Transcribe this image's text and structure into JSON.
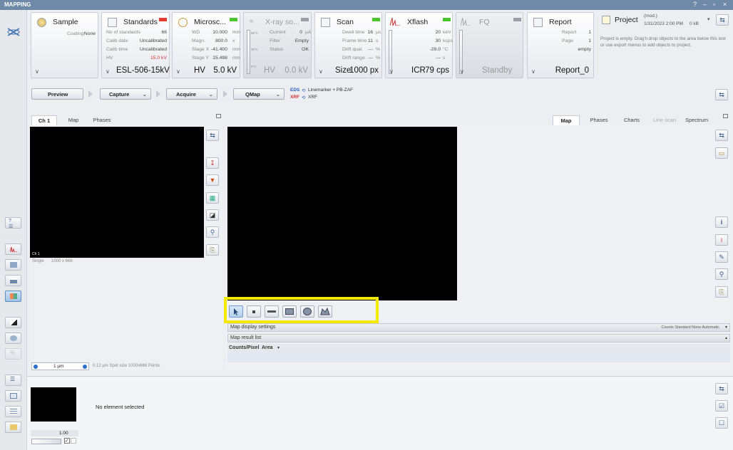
{
  "window": {
    "title": "MAPPING",
    "controls": [
      "?",
      "–",
      "▫",
      "×"
    ]
  },
  "sample": {
    "title": "Sample",
    "coating_label": "Coating",
    "coating_value": "None"
  },
  "standards": {
    "title": "Standards",
    "led": "#e23b2e",
    "rows": [
      {
        "k": "No of standards",
        "v": "66"
      },
      {
        "k": "Calib date",
        "v": "Uncalibrated"
      },
      {
        "k": "Calib time",
        "v": "Uncalibrated"
      },
      {
        "k": "HV",
        "v": "15.0 kV"
      }
    ],
    "footer": "ESL-506-15kV"
  },
  "microscope": {
    "title": "Microsc...",
    "led": "#4cc42f",
    "rows": [
      {
        "k": "WD",
        "v": "10.000",
        "u": "mm"
      },
      {
        "k": "Magn.",
        "v": "800.0",
        "u": "x"
      },
      {
        "k": "Stage X",
        "v": "-41.400",
        "u": "mm"
      },
      {
        "k": "Stage Y",
        "v": "15.498",
        "u": "mm"
      }
    ],
    "footer_label": "HV",
    "footer_value": "5.0 kV"
  },
  "xray": {
    "title": "X-ray so...",
    "led": "#9aa0a8",
    "scale": [
      "60°C",
      "30°C",
      "0°C"
    ],
    "rows": [
      {
        "k": "Current",
        "v": "0",
        "u": "μA"
      },
      {
        "k": "Filter",
        "v": "Empty",
        "u": ""
      },
      {
        "k": "Status",
        "v": "OK",
        "u": ""
      }
    ],
    "footer_label": "HV",
    "footer_value": "0.0 kV"
  },
  "scan": {
    "title": "Scan",
    "led": "#4cc42f",
    "rows": [
      {
        "k": "Dwell time",
        "v": "16",
        "u": "μs"
      },
      {
        "k": "Frame time",
        "v": "11",
        "u": "s"
      },
      {
        "k": "Drift qual.",
        "v": "---",
        "u": "%"
      },
      {
        "k": "Drift range",
        "v": "---",
        "u": "%"
      }
    ],
    "footer_label": "Size",
    "footer_value": "1000 px"
  },
  "xflash": {
    "title": "Xflash",
    "led": "#4cc42f",
    "rows": [
      {
        "v": "20",
        "u": "keV"
      },
      {
        "v": "30",
        "u": "kcps"
      },
      {
        "v": "-29.0",
        "u": "°C"
      },
      {
        "v": "---",
        "u": "s"
      }
    ],
    "footer_label": "ICR",
    "footer_value": "79 cps"
  },
  "fq": {
    "title": "FQ",
    "led": "#9aa0a8",
    "footer": "Standby"
  },
  "report": {
    "title": "Report",
    "rows": [
      {
        "k": "Report",
        "v": "1"
      },
      {
        "k": "Page",
        "v": "1"
      },
      {
        "k": "",
        "v": "empty"
      }
    ],
    "footer": "Report_0"
  },
  "project": {
    "title": "Project",
    "mod": "(mod.)",
    "date": "1/31/2023 2:00 PM",
    "size": "0 kB",
    "info": "Project is empty. Drag'n drop objects to the area below this text or use export menus to add objects to project."
  },
  "workflow": {
    "preview": "Preview",
    "capture": "Capture",
    "acquire": "Acquire",
    "qmap": "QMap",
    "eds_label": "EDS",
    "eds_text": "Linemarker + PB-ZAF",
    "xrf_label": "XRF",
    "xrf_text": "XRF"
  },
  "left_tabs": [
    "Ch 1",
    "Map",
    "Phases"
  ],
  "left_image": {
    "tag": "Ch 1",
    "mode": "Single",
    "dims": "1000 x 666"
  },
  "scale_bar": {
    "label": "1 μm",
    "info": "0.12 μm Spot size   1000x666 Points"
  },
  "right_tabs": [
    "Map",
    "Phases",
    "Charts",
    "Line scan",
    "Spectrum"
  ],
  "map_display": {
    "title": "Map display settings",
    "options": "Counts  Standard  None  Automatic"
  },
  "map_result": {
    "title": "Map result list"
  },
  "counts": {
    "label": "Counts/Pixel",
    "area": "Area"
  },
  "bottom": {
    "no_element": "No element selected",
    "zoom": "1.00"
  },
  "colors": {
    "highlight": "#f4ea00",
    "titlebar": "#6f8aa8",
    "accent": "#3a5b85"
  }
}
